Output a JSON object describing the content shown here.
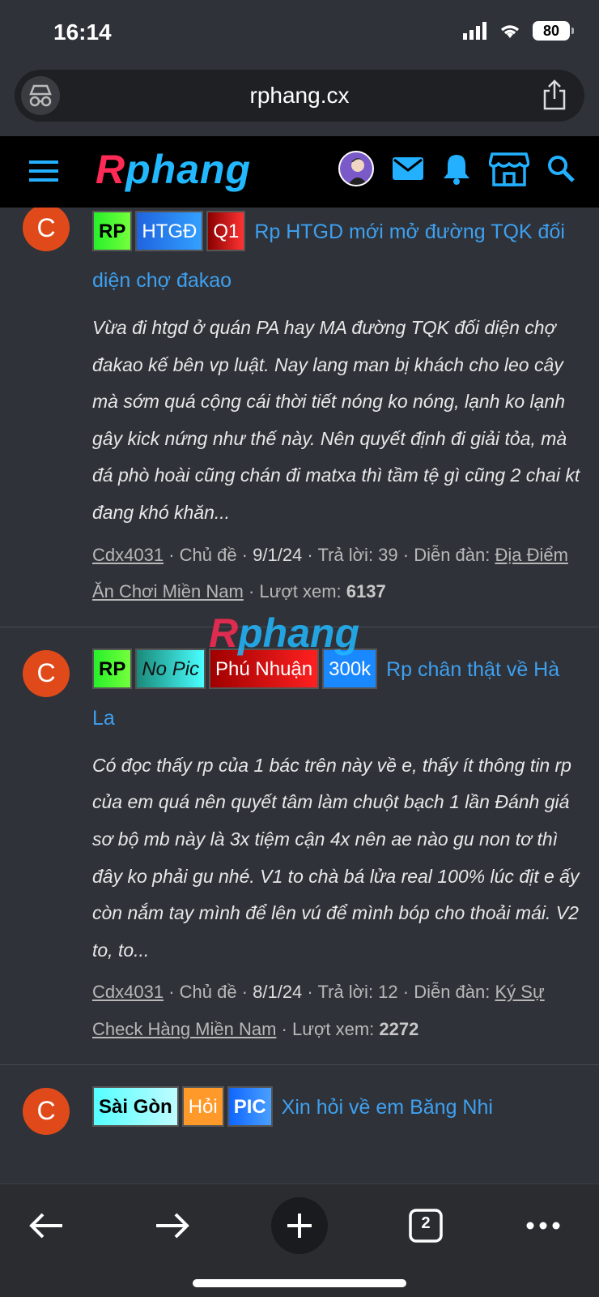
{
  "status": {
    "time": "16:14",
    "battery": "80"
  },
  "browser": {
    "url": "rphang.cx",
    "tabs_count": "2"
  },
  "site": {
    "logo_r": "R",
    "logo_rest": "phang"
  },
  "watermark": {
    "r": "R",
    "rest": "phang"
  },
  "threads": [
    {
      "avatar": "C",
      "tags": [
        "RP",
        "HTGĐ",
        "Q1"
      ],
      "title": "Rp HTGD mới mở đường TQK đối diện chợ đakao",
      "excerpt": "Vừa đi htgd ở quán PA hay MA đường TQK đối diện chợ đakao kế bên vp luật. Nay lang man bị khách cho leo cây mà sớm quá cộng cái thời tiết nóng ko nóng, lạnh ko lạnh gây kick nứng như thế này. Nên quyết định đi giải tỏa, mà đá phò hoài cũng chán đi matxa thì tầm tệ gì cũng 2 chai kt đang khó khăn...",
      "author": "Cdx4031",
      "sep1": " · Chủ đề · ",
      "date": "9/1/24",
      "replies": " · Trả lời: 39 · Diễn đàn: ",
      "forum": "Địa Điểm Ăn Chơi Miền Nam",
      "views_label": " · Lượt xem: ",
      "views": "6137"
    },
    {
      "avatar": "C",
      "tags": [
        "RP",
        "No Pic",
        "Phú Nhuận",
        "300k"
      ],
      "title": "Rp chân thật về Hà La",
      "excerpt": "Có đọc thấy rp của 1 bác trên này về e, thấy ít thông tin rp của em quá nên quyết tâm làm chuột bạch 1 lần Đánh giá sơ bộ mb này là 3x tiệm cận 4x nên ae nào gu non tơ thì đây ko phải gu nhé. V1 to chà bá lửa real 100% lúc địt e ấy còn nắm tay mình để lên vú để mình bóp cho thoải mái. V2 to, to...",
      "author": "Cdx4031",
      "sep1": " · Chủ đề · ",
      "date": "8/1/24",
      "replies": " · Trả lời: 12 · Diễn đàn: ",
      "forum": "Ký Sự Check Hàng Miền Nam",
      "views_label": " · Lượt xem: ",
      "views": "2272"
    },
    {
      "avatar": "C",
      "tags": [
        "Sài Gòn",
        "Hỏi",
        "PIC"
      ],
      "title": "Xin hỏi về em Băng Nhi"
    }
  ],
  "icons": [
    "incognito-icon",
    "share-icon",
    "menu-icon",
    "mail-icon",
    "bell-icon",
    "store-icon",
    "search-icon",
    "back-icon",
    "forward-icon",
    "plus-icon",
    "tabs-icon",
    "more-icon"
  ]
}
